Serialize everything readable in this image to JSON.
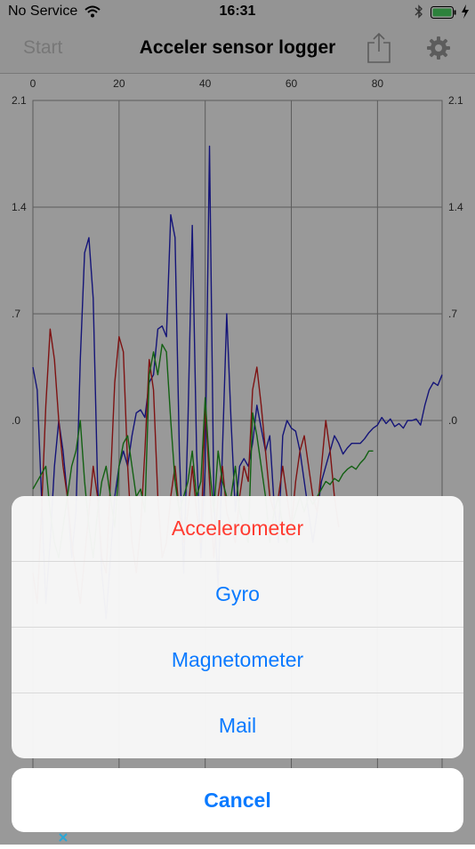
{
  "status_bar": {
    "carrier": "No Service",
    "time": "16:31"
  },
  "nav": {
    "left_button": "Start",
    "title": "Acceler sensor logger",
    "share_icon": "share-icon",
    "settings_icon": "gear-icon"
  },
  "chart_data": {
    "type": "line",
    "x_ticks": [
      "0",
      "20",
      "40",
      "60",
      "80"
    ],
    "y_ticks": [
      "2.1",
      "1.4",
      ".7",
      ".0"
    ],
    "xlim": [
      0,
      95
    ],
    "ylim": [
      -2.1,
      2.1
    ],
    "colors": [
      "#2222c8",
      "#d21e1e",
      "#1ea01e"
    ],
    "series": [
      {
        "values": [
          0.35,
          0.2,
          -0.5,
          -1.2,
          -0.8,
          -0.3,
          0.0,
          -0.2,
          -0.5,
          -0.9,
          -0.6,
          0.4,
          1.1,
          1.2,
          0.8,
          -0.4,
          -1.0,
          -1.3,
          -0.9,
          -0.5,
          -0.3,
          -0.2,
          -0.3,
          -0.1,
          0.05,
          0.07,
          0.02,
          0.25,
          0.3,
          0.6,
          0.62,
          0.55,
          1.35,
          1.2,
          -0.2,
          -1.0,
          0.0,
          1.28,
          -0.2,
          -0.9,
          -0.3,
          1.8,
          -0.5,
          -1.1,
          -0.2,
          0.7,
          0.0,
          -0.6,
          -0.3,
          -0.25,
          -0.3,
          -0.15,
          0.1,
          -0.05,
          -0.2,
          -0.1,
          -0.55,
          -0.8,
          -0.1,
          0.0,
          -0.05,
          -0.07,
          -0.2,
          -0.4,
          -0.6,
          -0.8,
          -0.6,
          -0.4,
          -0.3,
          -0.2,
          -0.1,
          -0.15,
          -0.22,
          -0.18,
          -0.15,
          -0.15,
          -0.15,
          -0.12,
          -0.08,
          -0.05,
          -0.03,
          0.02,
          -0.02,
          0.01,
          -0.04,
          -0.02,
          -0.05,
          0.0,
          0.0,
          0.01,
          -0.03,
          0.1,
          0.2,
          0.25,
          0.23,
          0.3
        ]
      },
      {
        "values": [
          -1.0,
          -1.2,
          -0.6,
          0.1,
          0.6,
          0.4,
          0.0,
          -0.3,
          -0.5,
          -0.8,
          -1.0,
          -1.2,
          -0.9,
          -0.6,
          -0.3,
          -0.5,
          -0.9,
          -1.0,
          -0.4,
          0.25,
          0.55,
          0.45,
          -0.3,
          -0.8,
          -1.0,
          -0.7,
          -0.2,
          0.4,
          0.2,
          -0.5,
          -0.9,
          -0.8,
          -0.5,
          -0.3,
          -0.6,
          -0.8,
          -0.6,
          -0.3,
          -0.6,
          -0.8,
          0.1,
          -0.4,
          -0.9,
          -0.5,
          -0.3,
          -0.6,
          -0.7,
          -0.8,
          -0.5,
          -0.3,
          -0.4,
          0.2,
          0.35,
          0.1,
          -0.2,
          -0.5,
          -0.6,
          -0.5,
          -0.3,
          -0.5,
          -0.7,
          -0.4,
          -0.2,
          -0.1,
          -0.3,
          -0.5,
          -0.6,
          -0.3,
          0.0,
          -0.2,
          -0.5,
          -0.7
        ]
      },
      {
        "values": [
          -0.45,
          -0.4,
          -0.35,
          -0.3,
          -0.6,
          -0.8,
          -0.9,
          -0.7,
          -0.5,
          -0.3,
          -0.2,
          0.0,
          -0.4,
          -0.7,
          -0.9,
          -0.6,
          -0.4,
          -0.3,
          -0.5,
          -0.7,
          -0.3,
          -0.15,
          -0.1,
          -0.3,
          -0.5,
          -0.45,
          -0.6,
          0.3,
          0.45,
          0.3,
          0.5,
          0.45,
          0.0,
          -0.4,
          -0.6,
          -0.5,
          -0.4,
          -0.2,
          -0.5,
          -0.4,
          0.15,
          -0.3,
          -0.6,
          -0.2,
          -0.4,
          -0.5,
          -0.5,
          -0.3,
          -0.6,
          -0.7,
          -0.8,
          0.05,
          -0.1,
          -0.3,
          -0.5,
          -0.8,
          -0.6,
          -0.5,
          -0.7,
          -0.8,
          -0.7,
          -0.6,
          -0.5,
          -0.6,
          -0.5,
          -0.55,
          -0.5,
          -0.45,
          -0.4,
          -0.42,
          -0.38,
          -0.4,
          -0.35,
          -0.32,
          -0.3,
          -0.32,
          -0.28,
          -0.25,
          -0.2,
          -0.2
        ]
      }
    ]
  },
  "sheet": {
    "items": [
      {
        "label": "Accelerometer"
      },
      {
        "label": "Gyro"
      },
      {
        "label": "Magnetometer"
      },
      {
        "label": "Mail"
      }
    ],
    "cancel": "Cancel"
  }
}
